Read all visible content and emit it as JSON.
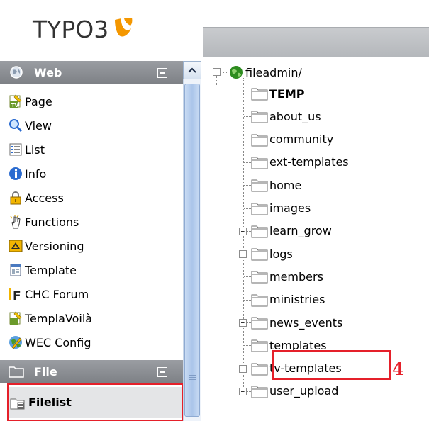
{
  "logo": {
    "text": "TYPO3"
  },
  "colors": {
    "highlight": "#e5202a",
    "section_header": "#8a8d92",
    "typo3_orange": "#f49700"
  },
  "sections": {
    "web": {
      "label": "Web",
      "icon": "globe-icon"
    },
    "file": {
      "label": "File",
      "icon": "folder-icon"
    }
  },
  "web_modules": [
    {
      "label": "Page",
      "icon": "page-tv-icon"
    },
    {
      "label": "View",
      "icon": "magnifier-icon"
    },
    {
      "label": "List",
      "icon": "list-icon"
    },
    {
      "label": "Info",
      "icon": "info-icon"
    },
    {
      "label": "Access",
      "icon": "lock-icon"
    },
    {
      "label": "Functions",
      "icon": "hand-icon"
    },
    {
      "label": "Versioning",
      "icon": "versioning-icon"
    },
    {
      "label": "Template",
      "icon": "template-icon"
    },
    {
      "label": "CHC Forum",
      "icon": "forum-f-icon"
    },
    {
      "label": "TemplaVoilà",
      "icon": "templavoila-icon"
    },
    {
      "label": "WEC Config",
      "icon": "globe-pen-icon"
    }
  ],
  "file_modules": [
    {
      "label": "Filelist",
      "icon": "filelist-icon"
    }
  ],
  "tree": {
    "root": "fileadmin/",
    "folders": [
      {
        "label": "TEMP",
        "bold": true,
        "expandable": false
      },
      {
        "label": "about_us",
        "expandable": false
      },
      {
        "label": "community",
        "expandable": false
      },
      {
        "label": "ext-templates",
        "expandable": false
      },
      {
        "label": "home",
        "expandable": false
      },
      {
        "label": "images",
        "expandable": false
      },
      {
        "label": "learn_grow",
        "expandable": true
      },
      {
        "label": "logs",
        "expandable": true
      },
      {
        "label": "members",
        "expandable": false
      },
      {
        "label": "ministries",
        "expandable": false
      },
      {
        "label": "news_events",
        "expandable": true
      },
      {
        "label": "templates",
        "expandable": false
      },
      {
        "label": "tv-templates",
        "expandable": true
      },
      {
        "label": "user_upload",
        "expandable": true
      }
    ]
  },
  "annotation": {
    "step_number": "4"
  }
}
